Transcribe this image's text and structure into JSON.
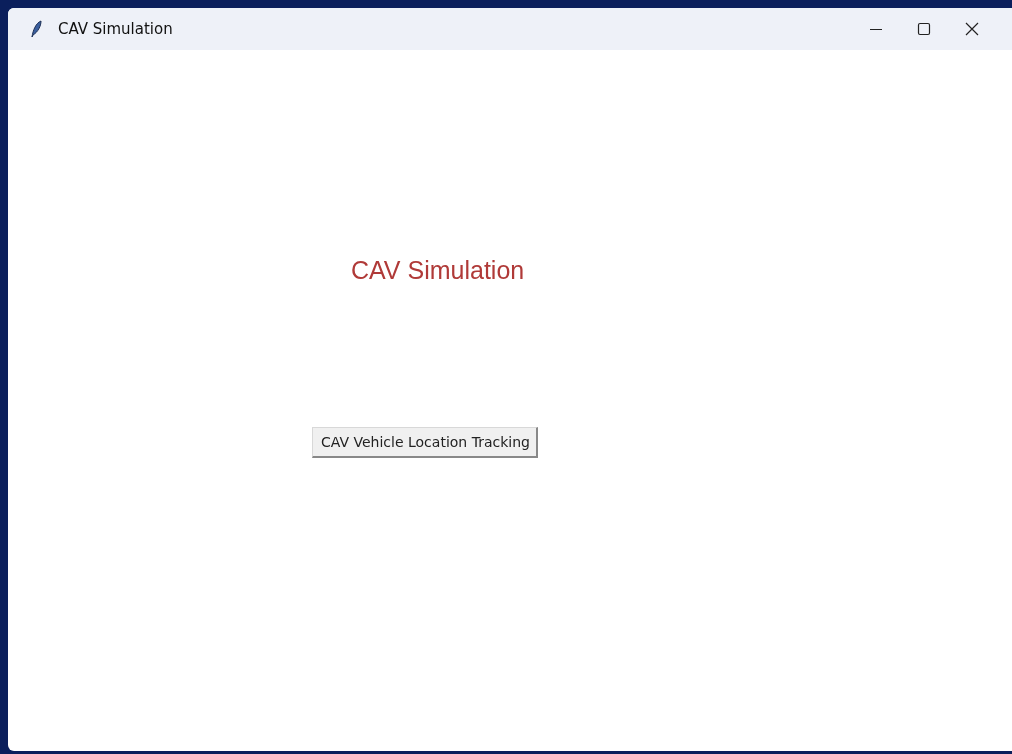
{
  "window": {
    "title": "CAV Simulation"
  },
  "heading": "CAV Simulation",
  "buttons": [
    {
      "label": "CAV Vehicle Location Tracking"
    }
  ]
}
